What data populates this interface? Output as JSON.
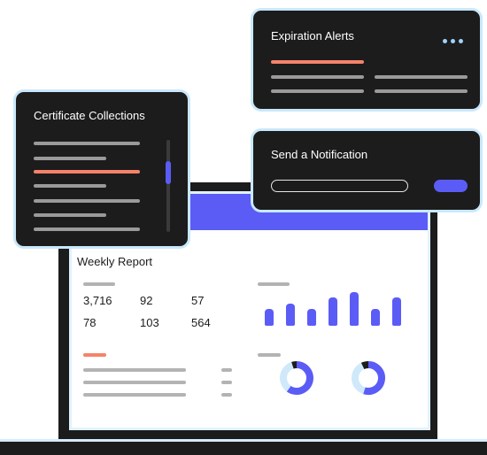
{
  "colors": {
    "dark": "#1c1c1c",
    "accent_purple": "#5b5cf6",
    "accent_orange": "#f5836a",
    "border_light_blue": "#c9e8fb",
    "placeholder_gray": "#9a9a9a"
  },
  "expiration_card": {
    "title": "Expiration Alerts",
    "menu_icon": "more-dots-icon"
  },
  "collections_card": {
    "title": "Certificate Collections"
  },
  "notification_card": {
    "title": "Send a Notification"
  },
  "report": {
    "title": "Weekly Report",
    "stats": [
      [
        "3,716",
        "92",
        "57"
      ],
      [
        "78",
        "103",
        "564"
      ]
    ]
  },
  "chart_data": [
    {
      "type": "bar",
      "values": [
        3,
        4,
        3,
        5,
        6,
        3,
        5
      ],
      "ylim": [
        0,
        6
      ]
    },
    {
      "type": "pie",
      "values": [
        60,
        35,
        5
      ],
      "colors": [
        "#5b5cf6",
        "#cfe9fb",
        "#1c1c1c"
      ]
    },
    {
      "type": "pie",
      "values": [
        55,
        38,
        7
      ],
      "colors": [
        "#5b5cf6",
        "#cfe9fb",
        "#1c1c1c"
      ]
    }
  ]
}
